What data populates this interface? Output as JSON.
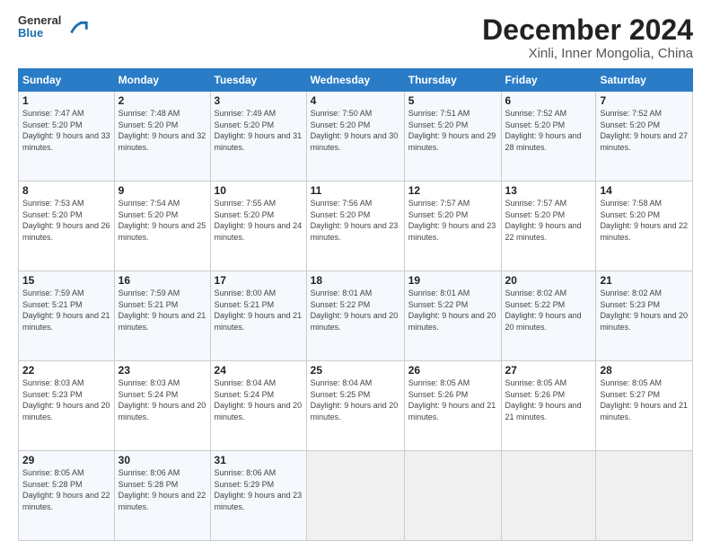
{
  "logo": {
    "general": "General",
    "blue": "Blue"
  },
  "title": "December 2024",
  "subtitle": "Xinli, Inner Mongolia, China",
  "days_header": [
    "Sunday",
    "Monday",
    "Tuesday",
    "Wednesday",
    "Thursday",
    "Friday",
    "Saturday"
  ],
  "weeks": [
    [
      {
        "day": 1,
        "sunrise": "7:47 AM",
        "sunset": "5:20 PM",
        "daylight": "9 hours and 33 minutes."
      },
      {
        "day": 2,
        "sunrise": "7:48 AM",
        "sunset": "5:20 PM",
        "daylight": "9 hours and 32 minutes."
      },
      {
        "day": 3,
        "sunrise": "7:49 AM",
        "sunset": "5:20 PM",
        "daylight": "9 hours and 31 minutes."
      },
      {
        "day": 4,
        "sunrise": "7:50 AM",
        "sunset": "5:20 PM",
        "daylight": "9 hours and 30 minutes."
      },
      {
        "day": 5,
        "sunrise": "7:51 AM",
        "sunset": "5:20 PM",
        "daylight": "9 hours and 29 minutes."
      },
      {
        "day": 6,
        "sunrise": "7:52 AM",
        "sunset": "5:20 PM",
        "daylight": "9 hours and 28 minutes."
      },
      {
        "day": 7,
        "sunrise": "7:52 AM",
        "sunset": "5:20 PM",
        "daylight": "9 hours and 27 minutes."
      }
    ],
    [
      {
        "day": 8,
        "sunrise": "7:53 AM",
        "sunset": "5:20 PM",
        "daylight": "9 hours and 26 minutes."
      },
      {
        "day": 9,
        "sunrise": "7:54 AM",
        "sunset": "5:20 PM",
        "daylight": "9 hours and 25 minutes."
      },
      {
        "day": 10,
        "sunrise": "7:55 AM",
        "sunset": "5:20 PM",
        "daylight": "9 hours and 24 minutes."
      },
      {
        "day": 11,
        "sunrise": "7:56 AM",
        "sunset": "5:20 PM",
        "daylight": "9 hours and 23 minutes."
      },
      {
        "day": 12,
        "sunrise": "7:57 AM",
        "sunset": "5:20 PM",
        "daylight": "9 hours and 23 minutes."
      },
      {
        "day": 13,
        "sunrise": "7:57 AM",
        "sunset": "5:20 PM",
        "daylight": "9 hours and 22 minutes."
      },
      {
        "day": 14,
        "sunrise": "7:58 AM",
        "sunset": "5:20 PM",
        "daylight": "9 hours and 22 minutes."
      }
    ],
    [
      {
        "day": 15,
        "sunrise": "7:59 AM",
        "sunset": "5:21 PM",
        "daylight": "9 hours and 21 minutes."
      },
      {
        "day": 16,
        "sunrise": "7:59 AM",
        "sunset": "5:21 PM",
        "daylight": "9 hours and 21 minutes."
      },
      {
        "day": 17,
        "sunrise": "8:00 AM",
        "sunset": "5:21 PM",
        "daylight": "9 hours and 21 minutes."
      },
      {
        "day": 18,
        "sunrise": "8:01 AM",
        "sunset": "5:22 PM",
        "daylight": "9 hours and 20 minutes."
      },
      {
        "day": 19,
        "sunrise": "8:01 AM",
        "sunset": "5:22 PM",
        "daylight": "9 hours and 20 minutes."
      },
      {
        "day": 20,
        "sunrise": "8:02 AM",
        "sunset": "5:22 PM",
        "daylight": "9 hours and 20 minutes."
      },
      {
        "day": 21,
        "sunrise": "8:02 AM",
        "sunset": "5:23 PM",
        "daylight": "9 hours and 20 minutes."
      }
    ],
    [
      {
        "day": 22,
        "sunrise": "8:03 AM",
        "sunset": "5:23 PM",
        "daylight": "9 hours and 20 minutes."
      },
      {
        "day": 23,
        "sunrise": "8:03 AM",
        "sunset": "5:24 PM",
        "daylight": "9 hours and 20 minutes."
      },
      {
        "day": 24,
        "sunrise": "8:04 AM",
        "sunset": "5:24 PM",
        "daylight": "9 hours and 20 minutes."
      },
      {
        "day": 25,
        "sunrise": "8:04 AM",
        "sunset": "5:25 PM",
        "daylight": "9 hours and 20 minutes."
      },
      {
        "day": 26,
        "sunrise": "8:05 AM",
        "sunset": "5:26 PM",
        "daylight": "9 hours and 21 minutes."
      },
      {
        "day": 27,
        "sunrise": "8:05 AM",
        "sunset": "5:26 PM",
        "daylight": "9 hours and 21 minutes."
      },
      {
        "day": 28,
        "sunrise": "8:05 AM",
        "sunset": "5:27 PM",
        "daylight": "9 hours and 21 minutes."
      }
    ],
    [
      {
        "day": 29,
        "sunrise": "8:05 AM",
        "sunset": "5:28 PM",
        "daylight": "9 hours and 22 minutes."
      },
      {
        "day": 30,
        "sunrise": "8:06 AM",
        "sunset": "5:28 PM",
        "daylight": "9 hours and 22 minutes."
      },
      {
        "day": 31,
        "sunrise": "8:06 AM",
        "sunset": "5:29 PM",
        "daylight": "9 hours and 23 minutes."
      },
      null,
      null,
      null,
      null
    ]
  ]
}
